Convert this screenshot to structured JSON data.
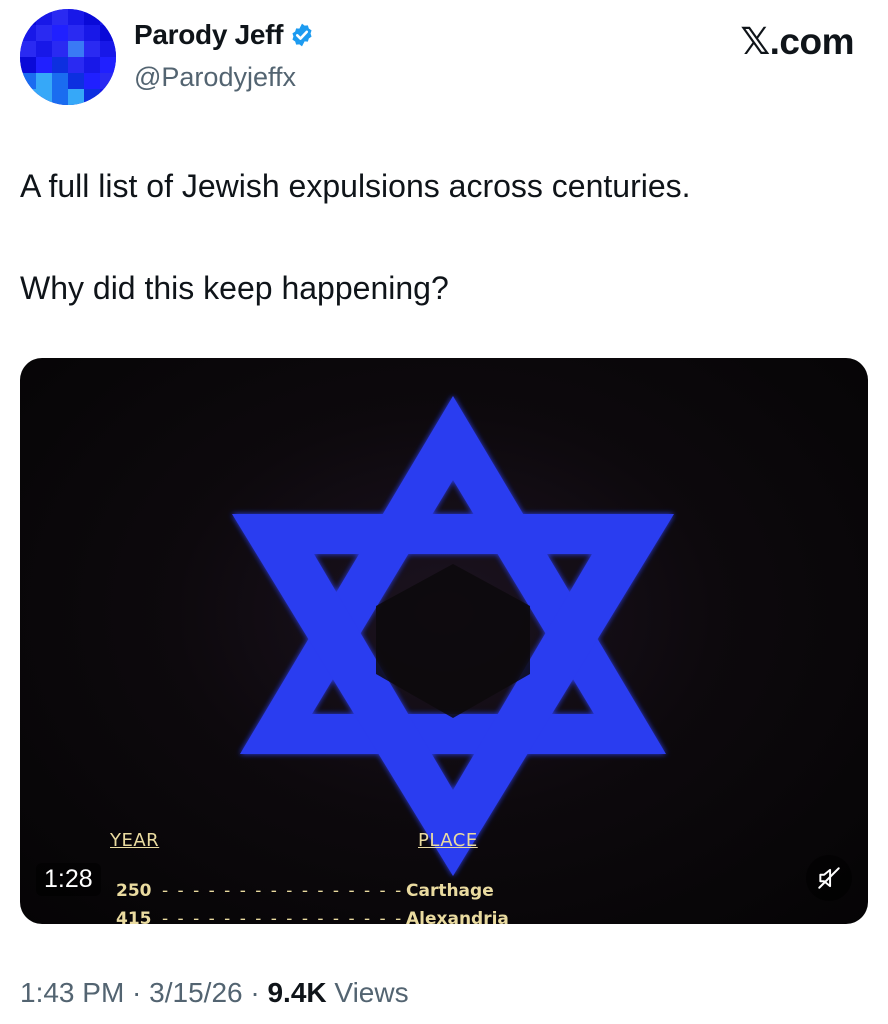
{
  "author": {
    "display_name": "Parody Jeff",
    "handle": "@Parodyjeffx",
    "verified": true,
    "avatar": "pixelated-blue-avatar"
  },
  "site": {
    "label": "𝕏.com"
  },
  "tweet": {
    "paragraphs": [
      "A full list of Jewish expulsions across centuries.",
      "Why did this keep happening?"
    ]
  },
  "media": {
    "type": "video",
    "image": "blue-star-of-david-on-dark-background",
    "duration": "1:28",
    "muted": true,
    "column_headers": {
      "year": "YEAR",
      "place": "PLACE"
    },
    "rows": [
      {
        "year": "250",
        "dots": "- - - - - - - - - - - - - - - -",
        "place": "Carthage"
      },
      {
        "year": "415",
        "dots": "- - - - - - - - - - - - - - - -",
        "place": "Alexandria"
      }
    ]
  },
  "meta": {
    "time": "1:43 PM",
    "sep1": " · ",
    "date": "3/15/26",
    "sep2": " · ",
    "views_count": "9.4K",
    "views_label": " Views"
  },
  "colors": {
    "text": "#0f1419",
    "secondary": "#536471",
    "verified_blue": "#1d9bf0",
    "star_blue": "#2b3cf0",
    "video_text": "#eadba0"
  }
}
